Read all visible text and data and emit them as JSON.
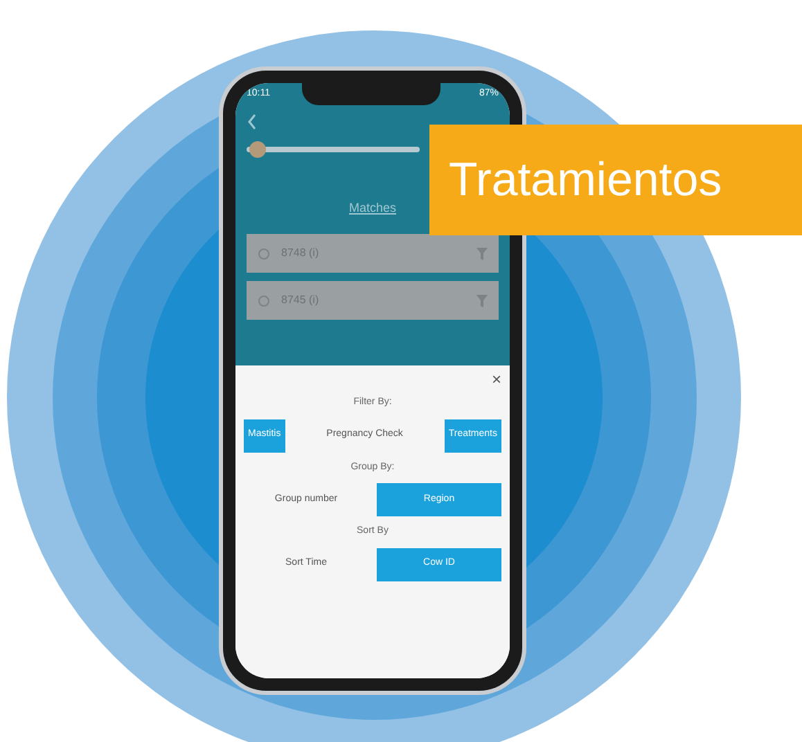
{
  "banner": {
    "title": "Tratamientos"
  },
  "phone": {
    "status_bar": {
      "time": "10:11",
      "battery": "87%"
    },
    "slider": {
      "level": 0.02
    },
    "list_title": "Matches",
    "rows": [
      {
        "id": "8748 (i)"
      },
      {
        "id": "8745 (i)"
      }
    ],
    "sheet": {
      "close": "×",
      "sections": [
        {
          "heading": "Filter By:",
          "options": [
            {
              "label": "Mastitis",
              "selected": true
            },
            {
              "label": "Pregnancy Check",
              "selected": false
            },
            {
              "label": "Treatments",
              "selected": true
            }
          ]
        },
        {
          "heading": "Group By:",
          "options": [
            {
              "label": "Group number",
              "selected": false
            },
            {
              "label": "Region",
              "selected": true
            }
          ]
        },
        {
          "heading": "Sort By",
          "options": [
            {
              "label": "Sort Time",
              "selected": false
            },
            {
              "label": "Cow ID",
              "selected": true
            }
          ]
        }
      ]
    }
  }
}
